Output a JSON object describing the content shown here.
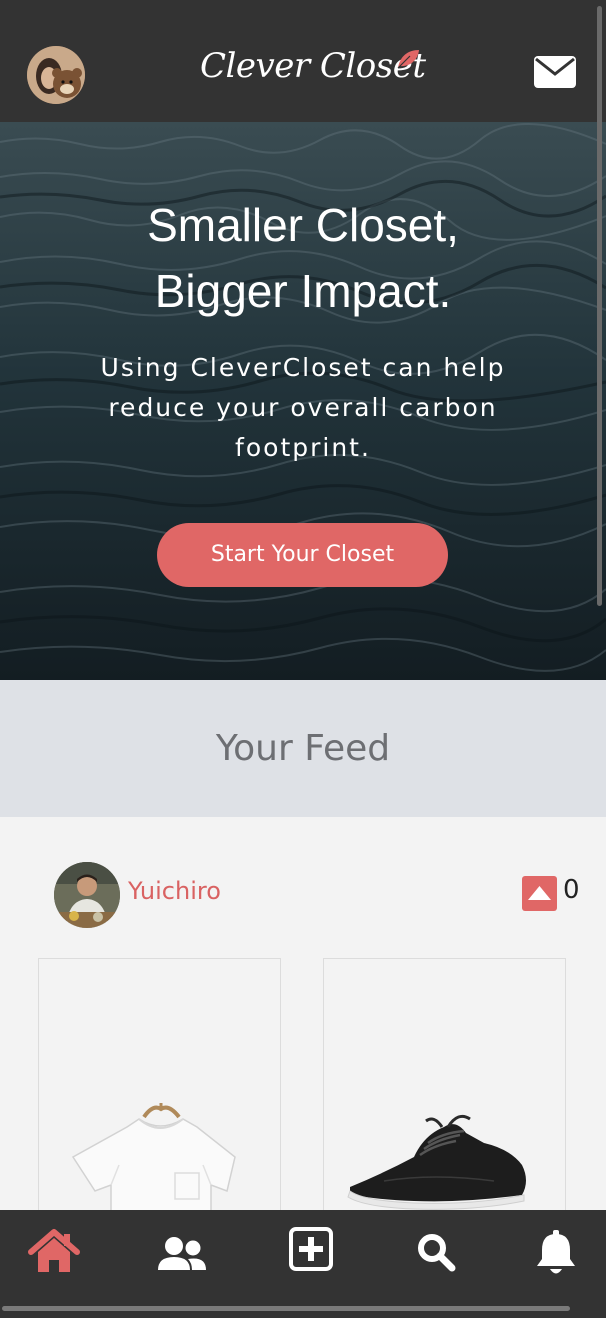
{
  "header": {
    "logo_text": "Clever Closet",
    "avatar_icon": "user-avatar-icon",
    "mail_icon": "envelope-icon"
  },
  "hero": {
    "title_line1": "Smaller Closet,",
    "title_line2": "Bigger Impact.",
    "subtitle": "Using CleverCloset can help reduce your overall carbon footprint.",
    "cta_label": "Start Your Closet"
  },
  "feed": {
    "title": "Your Feed",
    "post": {
      "username": "Yuichiro",
      "vote_count": "0",
      "items": [
        {
          "icon": "white-tshirt-image"
        },
        {
          "icon": "black-sneaker-image"
        }
      ]
    }
  },
  "bottom_nav": {
    "items": [
      {
        "icon": "home-icon",
        "active": true
      },
      {
        "icon": "users-icon",
        "active": false
      },
      {
        "icon": "plus-square-icon",
        "active": false
      },
      {
        "icon": "search-icon",
        "active": false
      },
      {
        "icon": "bell-icon",
        "active": false
      }
    ]
  },
  "colors": {
    "accent": "#e06766",
    "header_bg": "#333333",
    "feed_banner_bg": "#dee1e6",
    "feed_bg": "#f3f3f3"
  }
}
